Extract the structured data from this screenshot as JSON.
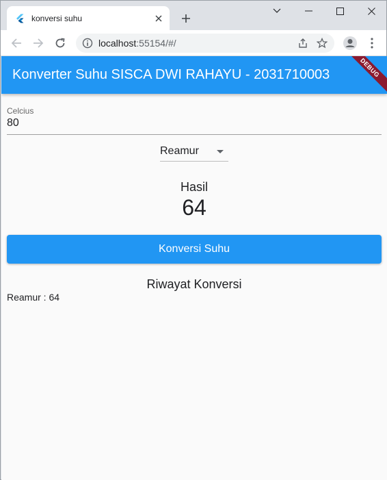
{
  "browser": {
    "tab_title": "konversi suhu",
    "url_host": "localhost",
    "url_rest": ":55154/#/"
  },
  "app": {
    "title": "Konverter Suhu SISCA DWI RAHAYU - 2031710003",
    "debug_banner": "DEBUG",
    "input": {
      "label": "Celcius",
      "value": "80"
    },
    "dropdown": {
      "selected": "Reamur"
    },
    "result": {
      "label": "Hasil",
      "value": "64"
    },
    "convert_button": "Konversi Suhu",
    "history": {
      "title": "Riwayat Konversi",
      "items": [
        "Reamur : 64"
      ]
    }
  },
  "colors": {
    "primary": "#2196f3",
    "background": "#fafafa",
    "debug_ribbon": "#8b1a2f"
  }
}
